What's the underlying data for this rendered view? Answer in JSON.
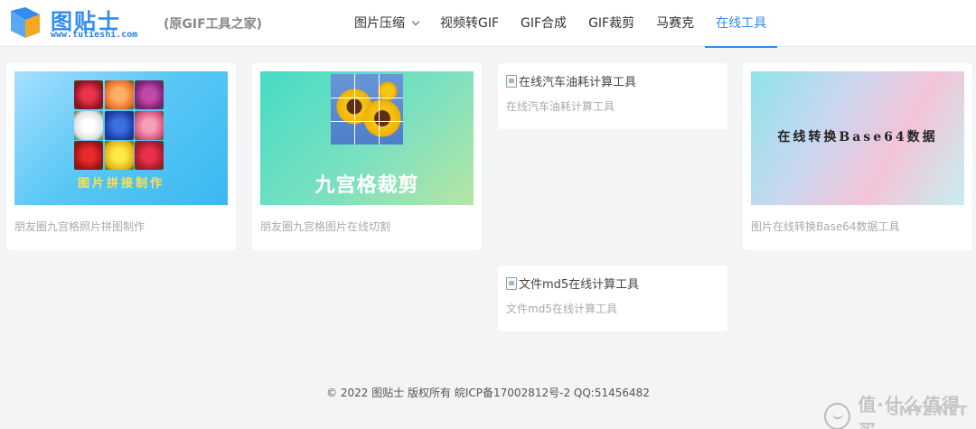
{
  "header": {
    "brand": "图贴士",
    "domain": "www.tutieshi.com",
    "subtitle": "(原GIF工具之家)",
    "nav": [
      {
        "label": "图片压缩",
        "dropdown": true
      },
      {
        "label": "视频转GIF"
      },
      {
        "label": "GIF合成"
      },
      {
        "label": "GIF裁剪"
      },
      {
        "label": "马赛克"
      },
      {
        "label": "在线工具",
        "active": true
      }
    ],
    "accent_color": "#2f8cf0"
  },
  "cards": [
    {
      "thumb_text": "图片拼接制作",
      "caption": "朋友圈九宫格照片拼图制作"
    },
    {
      "thumb_text": "九宫格裁剪",
      "caption": "朋友圈九宫格图片在线切割"
    },
    {
      "broken_alt": "在线汽车油耗计算工具",
      "caption": "在线汽车油耗计算工具"
    },
    {
      "thumb_text": "在线转换Base64数据",
      "caption": "图片在线转换Base64数据工具"
    },
    {
      "broken_alt": "文件md5在线计算工具",
      "caption": "文件md5在线计算工具"
    }
  ],
  "footer": {
    "text": "© 2022 图贴士 版权所有 皖ICP备17002812号-2 QQ:51456482"
  },
  "watermark": {
    "text": "值·什么值得买",
    "site": "SMYZ.NET"
  }
}
